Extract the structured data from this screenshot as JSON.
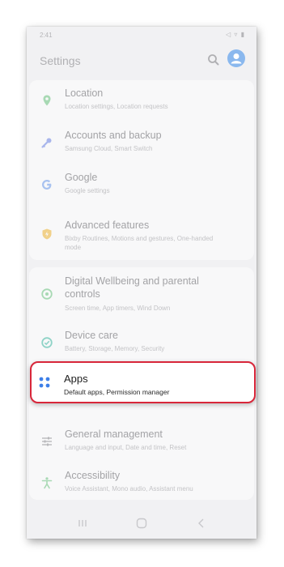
{
  "status": {
    "time": "2:41"
  },
  "header": {
    "title": "Settings"
  },
  "items": [
    {
      "title": "Location",
      "subtitle": "Location settings, Location requests"
    },
    {
      "title": "Accounts and backup",
      "subtitle": "Samsung Cloud, Smart Switch"
    },
    {
      "title": "Google",
      "subtitle": "Google settings"
    },
    {
      "title": "Advanced features",
      "subtitle": "Bixby Routines, Motions and gestures, One-handed mode"
    },
    {
      "title": "Digital Wellbeing and parental controls",
      "subtitle": "Screen time, App timers, Wind Down"
    },
    {
      "title": "Device care",
      "subtitle": "Battery, Storage, Memory, Security"
    },
    {
      "title": "Apps",
      "subtitle": "Default apps, Permission manager"
    },
    {
      "title": "General management",
      "subtitle": "Language and input, Date and time, Reset"
    },
    {
      "title": "Accessibility",
      "subtitle": "Voice Assistant, Mono audio, Assistant menu"
    }
  ],
  "colors": {
    "highlight_border": "#d8263a",
    "apps_icon": "#3d7fe8",
    "profile": "#8ab8ee"
  },
  "icons": {
    "location": "location-pin-icon",
    "accounts": "key-icon",
    "google": "google-icon",
    "advanced": "advanced-features-icon",
    "wellbeing": "wellbeing-icon",
    "device_care": "device-care-icon",
    "apps": "apps-icon",
    "general": "sliders-icon",
    "accessibility": "accessibility-icon"
  }
}
